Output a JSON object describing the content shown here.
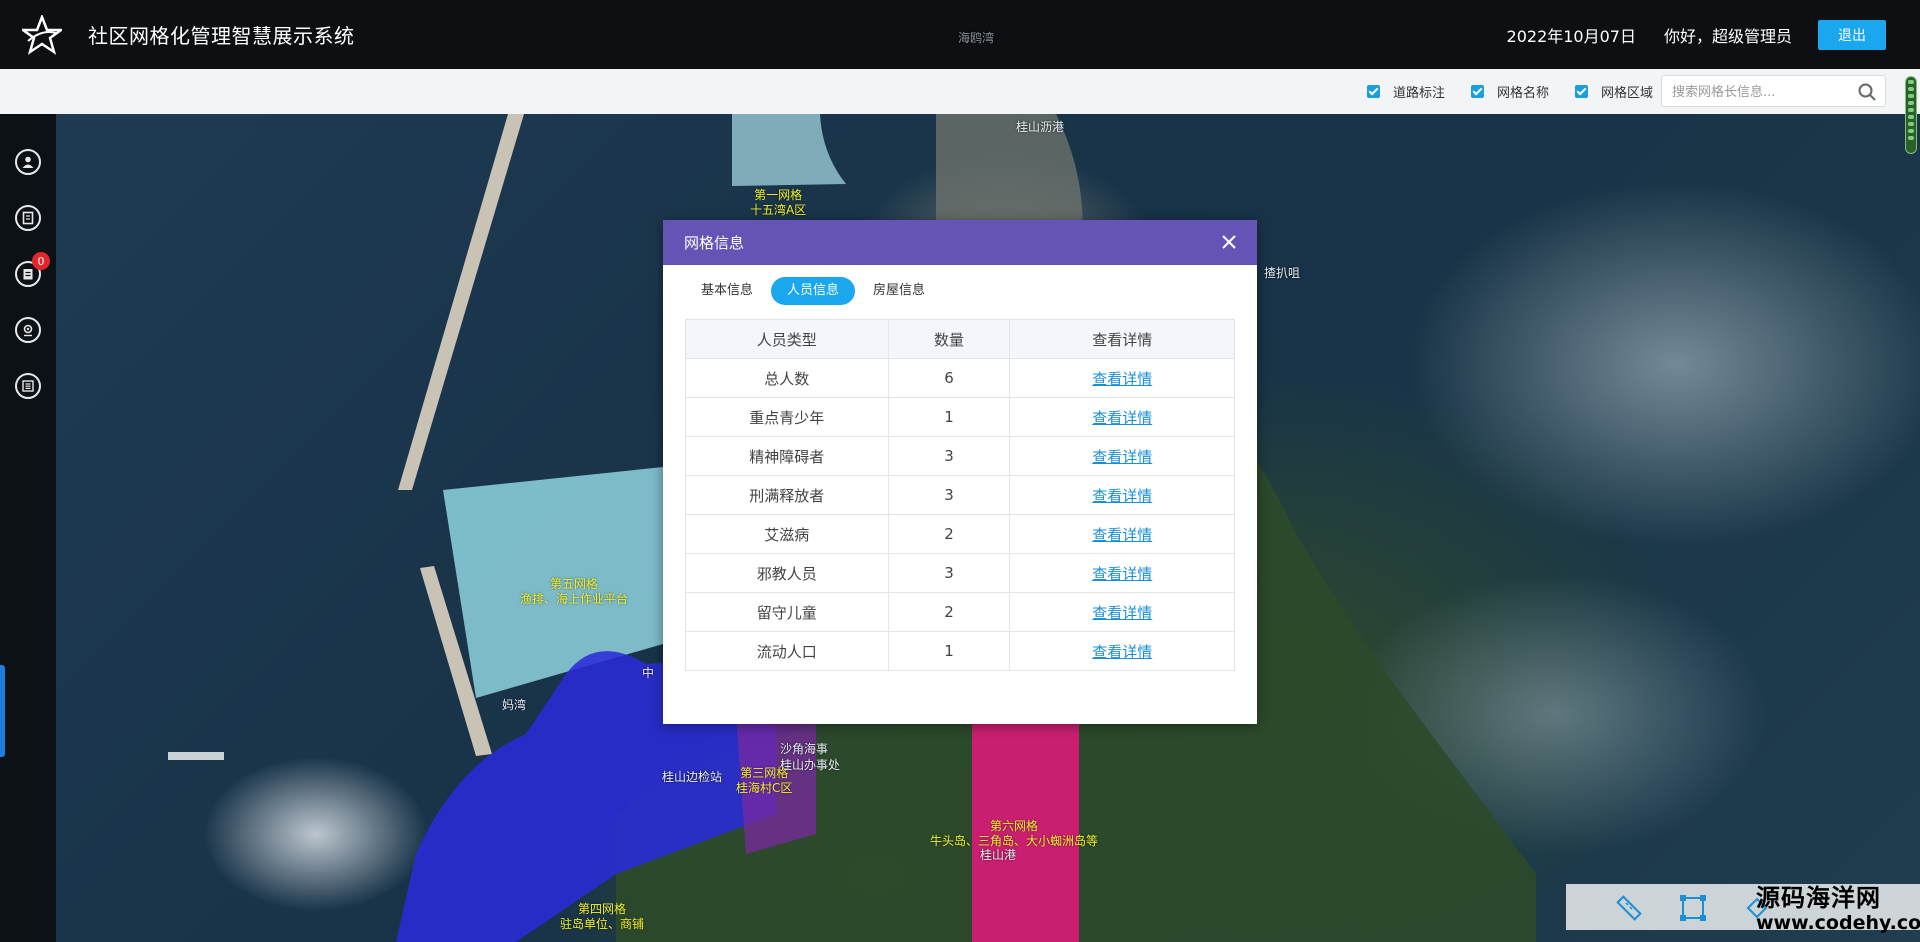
{
  "header": {
    "app_title": "社区网格化管理智慧展示系统",
    "date": "2022年10月07日",
    "greeting": "你好，超级管理员",
    "logout_label": "退出"
  },
  "toolbar": {
    "checks": [
      {
        "label": "道路标注",
        "checked": true
      },
      {
        "label": "网格名称",
        "checked": true
      },
      {
        "label": "网格区域",
        "checked": true
      }
    ],
    "search_placeholder": "搜索网格长信息..."
  },
  "sidebar": {
    "items": [
      "user-icon",
      "building-icon",
      "notice-icon",
      "location-icon",
      "list-icon"
    ],
    "badge": "0"
  },
  "map": {
    "grid_labels": [
      {
        "name": "第一网格",
        "area": "十五湾A区"
      },
      {
        "name": "第五网格",
        "area": "渔排、海上作业平台"
      },
      {
        "name": "第三网格",
        "area": "桂海村C区"
      },
      {
        "name": "第六网格",
        "area": "牛头岛、三角岛、大小蜘洲岛等"
      },
      {
        "name": "第四网格",
        "area": "驻岛单位、商铺"
      }
    ],
    "place_labels": [
      "海鸥湾",
      "桂山沥港",
      "揸扒咀",
      "妈湾",
      "桂山边检站",
      "沙角海事",
      "桂山办事处",
      "桂山港",
      "中"
    ]
  },
  "dialog": {
    "title": "网格信息",
    "tabs": [
      {
        "label": "基本信息",
        "active": false
      },
      {
        "label": "人员信息",
        "active": true
      },
      {
        "label": "房屋信息",
        "active": false
      }
    ],
    "table": {
      "headers": [
        "人员类型",
        "数量",
        "查看详情"
      ],
      "rows": [
        {
          "type": "总人数",
          "count": "6",
          "link": "查看详情"
        },
        {
          "type": "重点青少年",
          "count": "1",
          "link": "查看详情"
        },
        {
          "type": "精神障碍者",
          "count": "3",
          "link": "查看详情"
        },
        {
          "type": "刑满释放者",
          "count": "3",
          "link": "查看详情"
        },
        {
          "type": "艾滋病",
          "count": "2",
          "link": "查看详情"
        },
        {
          "type": "邪教人员",
          "count": "3",
          "link": "查看详情"
        },
        {
          "type": "留守儿童",
          "count": "2",
          "link": "查看详情"
        },
        {
          "type": "流动人口",
          "count": "1",
          "link": "查看详情"
        }
      ]
    }
  },
  "map_tools": [
    "ruler-icon",
    "polygon-measure-icon",
    "clear-icon"
  ],
  "watermark": {
    "title": "源码海洋网",
    "url": "www.codehy.com"
  },
  "colors": {
    "header_bg": "#0d0f12",
    "dialog_header": "#6554b6",
    "accent": "#1aa7ee",
    "badge": "#e4262b",
    "grid_label": "#f2ef2a"
  }
}
